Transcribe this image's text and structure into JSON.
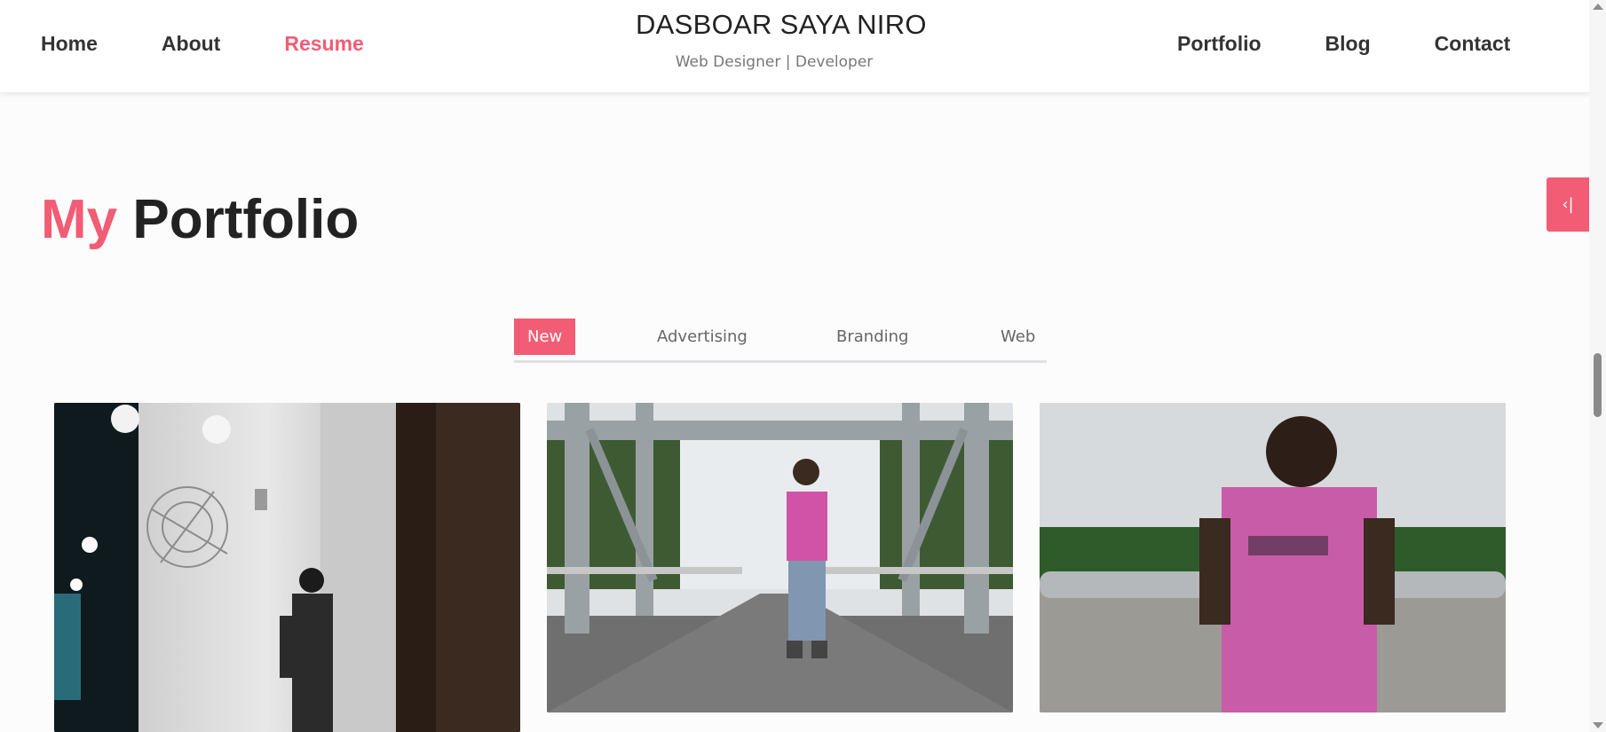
{
  "header": {
    "brand_title": "DASBOAR SAYA NIRO",
    "brand_subtitle": "Web Designer | Developer",
    "nav_left": [
      {
        "label": "Home",
        "active": false
      },
      {
        "label": "About",
        "active": false
      },
      {
        "label": "Resume",
        "active": true
      }
    ],
    "nav_right": [
      {
        "label": "Portfolio",
        "active": false
      },
      {
        "label": "Blog",
        "active": false
      },
      {
        "label": "Contact",
        "active": false
      }
    ]
  },
  "side_toggle": {
    "icon": "collapse-left-icon",
    "glyph": "‹|"
  },
  "portfolio": {
    "title_accent": "My",
    "title_rest": "Portfolio",
    "filters": [
      {
        "label": "New",
        "active": true
      },
      {
        "label": "Advertising",
        "active": false
      },
      {
        "label": "Branding",
        "active": false
      },
      {
        "label": "Web",
        "active": false
      }
    ],
    "items": [
      {
        "subject": "man-leaning-on-wall-at-night"
      },
      {
        "subject": "man-walking-on-bridge"
      },
      {
        "subject": "man-leaning-on-bridge-railing"
      }
    ]
  },
  "colors": {
    "accent": "#f25c75",
    "text": "#222222",
    "muted": "#777777"
  }
}
